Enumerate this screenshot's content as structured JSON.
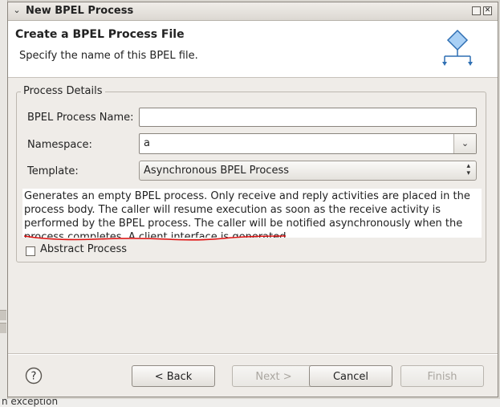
{
  "dialog": {
    "title": "New BPEL Process",
    "header_title": "Create a BPEL Process File",
    "header_description": "Specify the name of this BPEL file."
  },
  "group": {
    "legend": "Process Details"
  },
  "fields": {
    "process_name_label": "BPEL Process Name:",
    "process_name_value": "",
    "namespace_label": "Namespace:",
    "namespace_value": "a",
    "template_label": "Template:",
    "template_value": "Asynchronous BPEL Process"
  },
  "template_description": "Generates an empty BPEL process. Only receive and reply activities are placed in the process body. The caller will resume execution as soon as the receive activity is performed by the BPEL process. The caller will be notified asynchronously when the process completes. A client interface is generated",
  "abstract_process": {
    "label": "Abstract Process",
    "checked": false
  },
  "buttons": {
    "back": "< Back",
    "next": "Next >",
    "cancel": "Cancel",
    "finish": "Finish"
  },
  "background": {
    "status_text": "n exception"
  },
  "icons": {
    "title_chevron": "chevron-down-icon",
    "maximize": "maximize-icon",
    "close": "close-icon",
    "header": "bpel-process-diagram-icon",
    "help": "help-icon"
  },
  "colors": {
    "squiggle": "#e01010",
    "header_icon": "#4a90d9"
  }
}
